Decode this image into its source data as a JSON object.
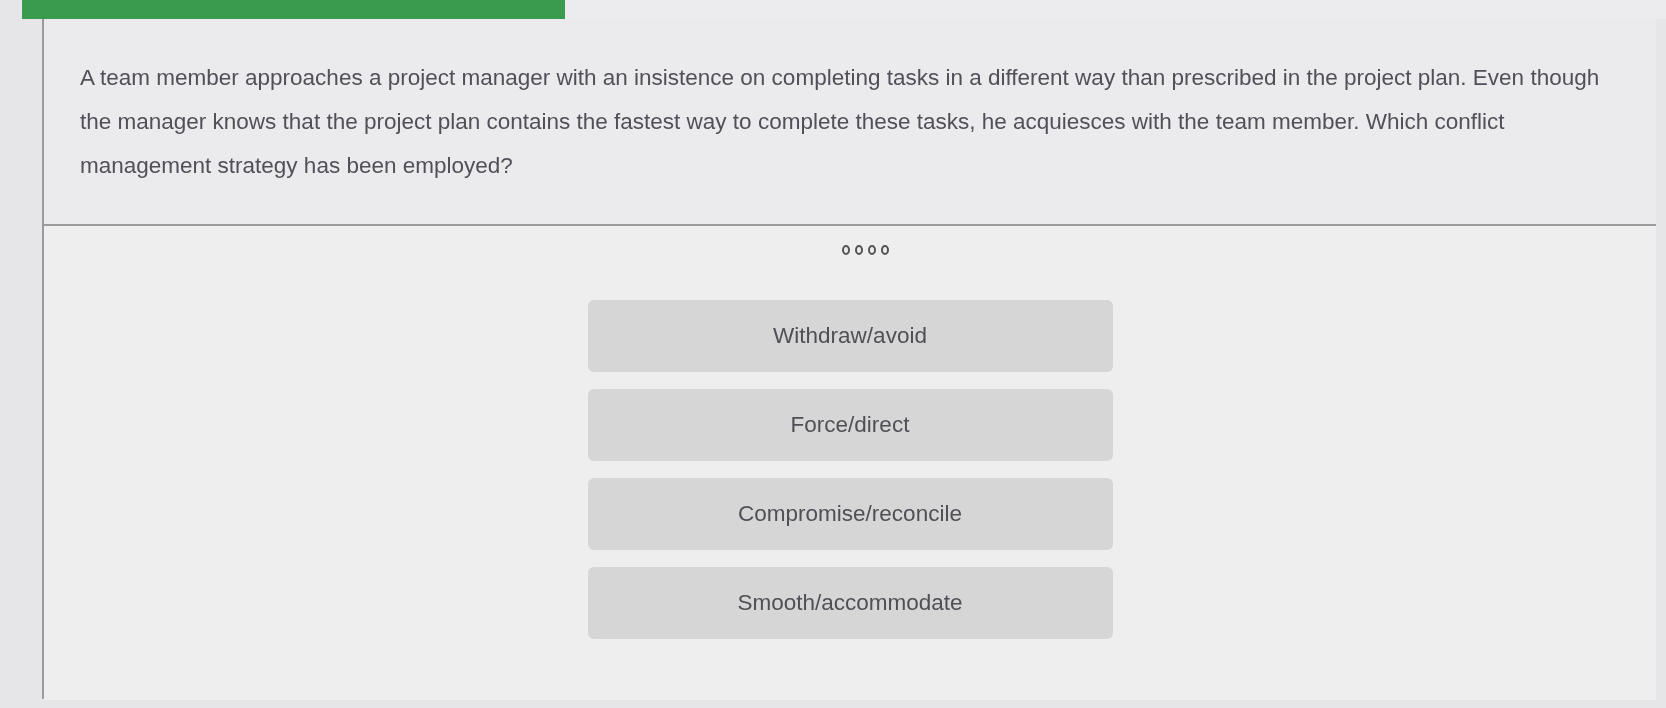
{
  "progress": {
    "level": 0.33
  },
  "question": "A team member approaches a project manager with an insistence on completing tasks in a different way than prescribed in the project plan. Even though the manager knows that the project plan contains the fastest way to complete these tasks, he acquiesces with the team member. Which conflict management strategy has been employed?",
  "pager_dots": [
    {
      "selected": false
    },
    {
      "selected": false
    },
    {
      "selected": false
    },
    {
      "selected": false
    }
  ],
  "answers": [
    {
      "label": "Withdraw/avoid",
      "selected": false
    },
    {
      "label": "Force/direct",
      "selected": false
    },
    {
      "label": "Compromise/reconcile",
      "selected": false
    },
    {
      "label": "Smooth/accommodate",
      "selected": false
    }
  ]
}
